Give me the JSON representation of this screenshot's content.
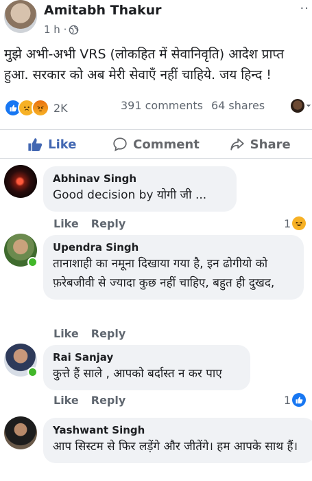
{
  "post": {
    "author": "Amitabh Thakur",
    "time": "1 h ·",
    "text": "मुझे अभी-अभी VRS (लोकहित में सेवानिवृति) आदेश प्राप्त हुआ. सरकार को अब मेरी सेवाएँ नहीं चाहिये. जय हिन्द !",
    "reaction_count": "2K",
    "comments": "391 comments",
    "shares": "64 shares"
  },
  "actions": {
    "like": "Like",
    "comment": "Comment",
    "share": "Share"
  },
  "comments": [
    {
      "name": "Abhinav Singh",
      "text": "Good decision by  योगी जी ...",
      "like": "Like",
      "reply": "Reply",
      "react_count": "1"
    },
    {
      "name": "Upendra Singh",
      "text": "तानाशाही का नमूना दिखाया गया है, इन ढोगीयो को फ़रेबजीवी से ज्यादा कुछ नहीं चाहिए, बहुत ही दुखद,",
      "like": "Like",
      "reply": "Reply"
    },
    {
      "name": "Rai Sanjay",
      "text": "कुत्ते हैं साले , आपको बर्दास्त न कर पाए",
      "like": "Like",
      "reply": "Reply",
      "react_count": "1"
    },
    {
      "name": "Yashwant Singh",
      "text": "आप सिस्टम से फिर लड़ेंगे और जीतेंगे। हम आपके साथ हैं।"
    }
  ],
  "colors": {
    "link_blue": "#4267b2",
    "gray": "#606770",
    "bubble": "#f0f2f5",
    "online": "#42b72a"
  },
  "icons": [
    "globe-icon",
    "more-icon",
    "like-thumb-icon",
    "comment-icon",
    "share-icon",
    "like-reaction-icon",
    "sad-reaction-icon",
    "angry-reaction-icon",
    "laugh-reaction-icon"
  ]
}
